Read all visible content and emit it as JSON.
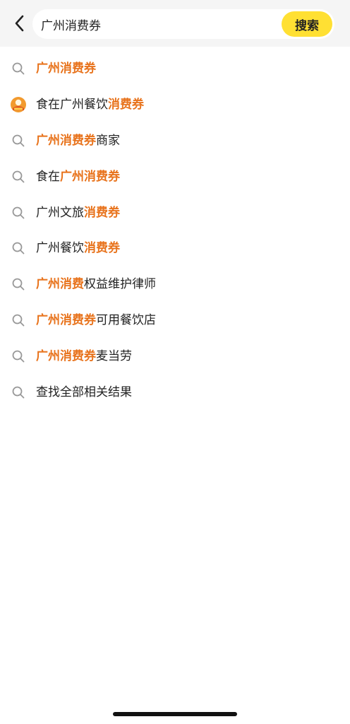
{
  "header": {
    "search": {
      "value": "广州消费券",
      "placeholder": ""
    },
    "search_button_label": "搜索"
  },
  "suggestions": [
    {
      "icon": "search-icon",
      "parts": [
        {
          "text": "广州消费券",
          "highlight": true
        }
      ]
    },
    {
      "icon": "badge-avatar-icon",
      "parts": [
        {
          "text": "食在广州餐饮",
          "highlight": false
        },
        {
          "text": "消费券",
          "highlight": true
        }
      ]
    },
    {
      "icon": "search-icon",
      "parts": [
        {
          "text": "广州消费券",
          "highlight": true
        },
        {
          "text": "商家",
          "highlight": false
        }
      ]
    },
    {
      "icon": "search-icon",
      "parts": [
        {
          "text": "食在",
          "highlight": false
        },
        {
          "text": "广州消费券",
          "highlight": true
        }
      ]
    },
    {
      "icon": "search-icon",
      "parts": [
        {
          "text": "广州文旅",
          "highlight": false
        },
        {
          "text": "消费券",
          "highlight": true
        }
      ]
    },
    {
      "icon": "search-icon",
      "parts": [
        {
          "text": "广州餐饮",
          "highlight": false
        },
        {
          "text": "消费券",
          "highlight": true
        }
      ]
    },
    {
      "icon": "search-icon",
      "parts": [
        {
          "text": "广州消费",
          "highlight": true
        },
        {
          "text": "权益维护律师",
          "highlight": false
        }
      ]
    },
    {
      "icon": "search-icon",
      "parts": [
        {
          "text": "广州消费券",
          "highlight": true
        },
        {
          "text": "可用餐饮店",
          "highlight": false
        }
      ]
    },
    {
      "icon": "search-icon",
      "parts": [
        {
          "text": "广州消费券",
          "highlight": true
        },
        {
          "text": "麦当劳",
          "highlight": false
        }
      ]
    },
    {
      "icon": "search-icon",
      "parts": [
        {
          "text": "查找全部相关结果",
          "highlight": false
        }
      ]
    }
  ],
  "colors": {
    "accent_yellow": "#ffe033",
    "highlight_orange": "#e8731c",
    "header_bg": "#f5f5f5",
    "text": "#222222",
    "icon_gray": "#999999"
  }
}
